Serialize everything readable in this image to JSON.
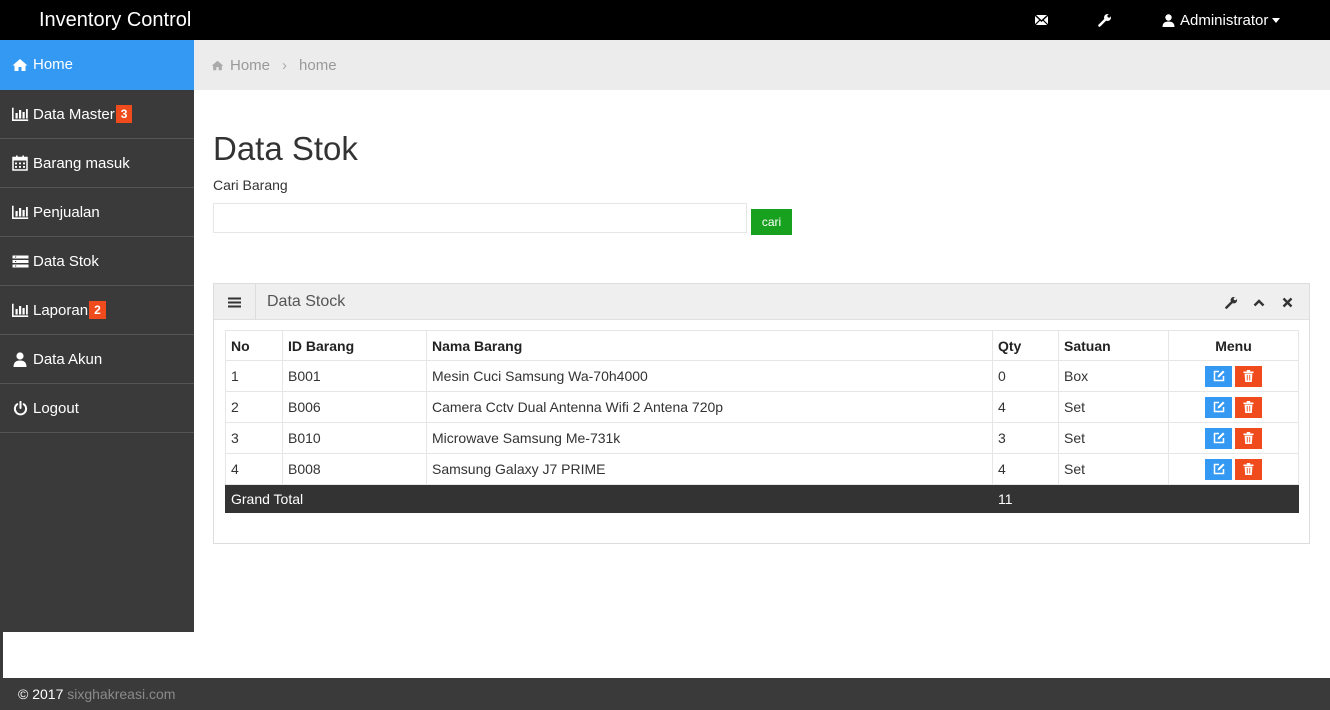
{
  "app": {
    "title": "Inventory Control"
  },
  "topbar": {
    "mail_icon": "envelope-icon",
    "settings_icon": "wrench-icon",
    "user_label": "Administrator"
  },
  "sidebar": {
    "items": [
      {
        "label": "Home",
        "icon": "home-icon",
        "active": true
      },
      {
        "label": "Data Master",
        "icon": "bar-chart-icon",
        "badge": "3"
      },
      {
        "label": "Barang masuk",
        "icon": "calendar-icon"
      },
      {
        "label": "Penjualan",
        "icon": "bar-chart-icon"
      },
      {
        "label": "Data Stok",
        "icon": "list-icon"
      },
      {
        "label": "Laporan",
        "icon": "bar-chart-icon",
        "badge": "2"
      },
      {
        "label": "Data Akun",
        "icon": "user-icon"
      },
      {
        "label": "Logout",
        "icon": "power-icon"
      }
    ]
  },
  "breadcrumb": {
    "root": "Home",
    "current": "home"
  },
  "main": {
    "title": "Data Stok",
    "search_label": "Cari Barang",
    "search_value": "",
    "search_button": "cari"
  },
  "panel": {
    "title": "Data Stock",
    "columns": [
      "No",
      "ID Barang",
      "Nama Barang",
      "Qty",
      "Satuan",
      "Menu"
    ],
    "rows": [
      {
        "no": "1",
        "id": "B001",
        "name": "Mesin Cuci Samsung Wa-70h4000",
        "qty": "0",
        "unit": "Box"
      },
      {
        "no": "2",
        "id": "B006",
        "name": "Camera Cctv Dual Antenna Wifi 2 Antena 720p",
        "qty": "4",
        "unit": "Set"
      },
      {
        "no": "3",
        "id": "B010",
        "name": "Microwave Samsung Me-731k",
        "qty": "3",
        "unit": "Set"
      },
      {
        "no": "4",
        "id": "B008",
        "name": "Samsung Galaxy J7 PRIME",
        "qty": "4",
        "unit": "Set"
      }
    ],
    "total_label": "Grand Total",
    "total_qty": "11"
  },
  "footer": {
    "copyright": "© 2017",
    "site": "sixghakreasi.com"
  },
  "colors": {
    "accent": "#3399f3",
    "danger": "#f04b1c",
    "success": "#18a11f",
    "sidebar": "#3a3a3a"
  }
}
